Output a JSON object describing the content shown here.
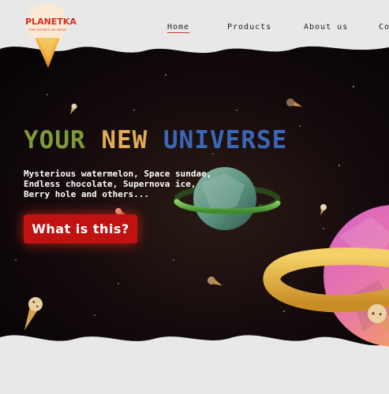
{
  "brand": {
    "name": "PLANETKA",
    "tagline": "YOUR FAVORITE ICE CREAM"
  },
  "nav": {
    "items": [
      {
        "label": "Home",
        "active": true
      },
      {
        "label": "Products",
        "active": false
      },
      {
        "label": "About us",
        "active": false
      },
      {
        "label": "Co",
        "active": false
      }
    ]
  },
  "hero": {
    "headline": {
      "word1": "YOUR",
      "word2": "NEW",
      "word3": "UNIVERSE"
    },
    "description": [
      "Mysterious watermelon, Space sundae,",
      "Endless chocolate, Supernova ice,",
      "Berry hole and others..."
    ],
    "cta_label": "What is this?"
  },
  "colors": {
    "background": "#e8e8e8",
    "space": "#0c0608",
    "accent_red": "#c11212",
    "headline_green": "#7f9a3c",
    "headline_yellow": "#e0ac55",
    "headline_blue": "#3b67b8"
  },
  "icons": {
    "logo": "ice-cream-cone-logo",
    "decor": [
      "ice-cream-cone",
      "green-ringed-planet",
      "pink-ringed-planet",
      "stars"
    ]
  }
}
